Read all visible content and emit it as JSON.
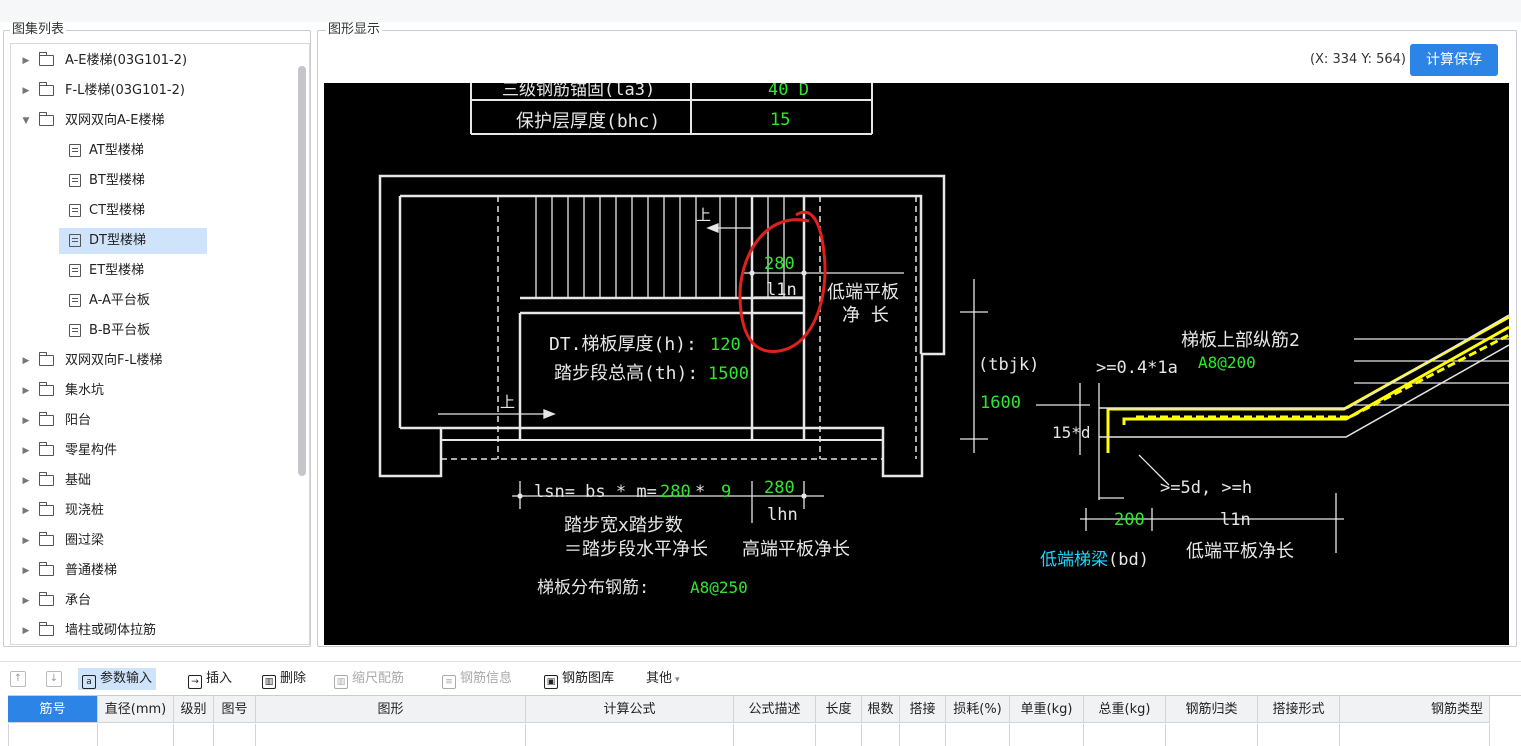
{
  "left_panel": {
    "title": "图集列表",
    "tree": [
      {
        "label": "A-E楼梯(03G101-2)",
        "type": "folder",
        "level": 0,
        "expanded": false
      },
      {
        "label": "F-L楼梯(03G101-2)",
        "type": "folder",
        "level": 0,
        "expanded": false
      },
      {
        "label": "双网双向A-E楼梯",
        "type": "folder",
        "level": 0,
        "expanded": true
      },
      {
        "label": "AT型楼梯",
        "type": "doc",
        "level": 1
      },
      {
        "label": "BT型楼梯",
        "type": "doc",
        "level": 1
      },
      {
        "label": "CT型楼梯",
        "type": "doc",
        "level": 1
      },
      {
        "label": "DT型楼梯",
        "type": "doc",
        "level": 1,
        "selected": true
      },
      {
        "label": "ET型楼梯",
        "type": "doc",
        "level": 1
      },
      {
        "label": "A-A平台板",
        "type": "doc",
        "level": 1
      },
      {
        "label": "B-B平台板",
        "type": "doc",
        "level": 1
      },
      {
        "label": "双网双向F-L楼梯",
        "type": "folder",
        "level": 0,
        "expanded": false
      },
      {
        "label": "集水坑",
        "type": "folder",
        "level": 0,
        "expanded": false
      },
      {
        "label": "阳台",
        "type": "folder",
        "level": 0,
        "expanded": false
      },
      {
        "label": "零星构件",
        "type": "folder",
        "level": 0,
        "expanded": false
      },
      {
        "label": "基础",
        "type": "folder",
        "level": 0,
        "expanded": false
      },
      {
        "label": "现浇桩",
        "type": "folder",
        "level": 0,
        "expanded": false
      },
      {
        "label": "圈过梁",
        "type": "folder",
        "level": 0,
        "expanded": false
      },
      {
        "label": "普通楼梯",
        "type": "folder",
        "level": 0,
        "expanded": false
      },
      {
        "label": "承台",
        "type": "folder",
        "level": 0,
        "expanded": false
      },
      {
        "label": "墙柱或砌体拉筋",
        "type": "folder",
        "level": 0,
        "expanded": false
      }
    ]
  },
  "right_panel": {
    "title": "图形显示",
    "coord_readout": "(X: 334 Y: 564)",
    "save_button": "计算保存"
  },
  "drawing": {
    "table_row1_label": "三级钢筋锚固(la3)",
    "table_row1_value": "40 D",
    "table_row2_label": "保护层厚度(bhc)",
    "table_row2_value": "15",
    "up_label": "上",
    "val_280": "280",
    "ln_label": "l1n",
    "low_slab_1": "低端平板",
    "low_slab_2": "净  长",
    "thickness_label": "DT.梯板厚度(h):",
    "thickness_value": "120",
    "height_label": "踏步段总高(th):",
    "height_value": "1500",
    "lsn_label": "lsn= bs * m=",
    "lsn_bs": "280",
    "lsn_star": "*",
    "lsn_m": "9",
    "hn_val": "280",
    "hn_label": "lhn",
    "step_note": "踏步宽x踏步数",
    "horiz_note": "＝踏步段水平净长",
    "high_slab_note": "高端平板净长",
    "distrib_label": "梯板分布钢筋:",
    "distrib_value": "A8@250",
    "tbjk": "(tbjk)",
    "tbjk_value": "1600",
    "top_bar_label": "梯板上部纵筋2",
    "top_bar_value": "A8@200",
    "anchor_04": ">=0.4*1a",
    "d15": "15*d",
    "d5": ">=5d, >=h",
    "val_200": "200",
    "ln2": "l1n",
    "low_beam": "低端梯梁",
    "bd": "(bd)",
    "low_slab_len": "低端平板净长"
  },
  "toolbar": {
    "param_input": "参数输入",
    "insert": "插入",
    "delete": "删除",
    "scale": "缩尺配筋",
    "rebar_info": "钢筋信息",
    "rebar_lib": "钢筋图库",
    "other": "其他"
  },
  "grid": {
    "columns": [
      "筋号",
      "直径(mm)",
      "级别",
      "图号",
      "图形",
      "计算公式",
      "公式描述",
      "长度",
      "根数",
      "搭接",
      "损耗(%)",
      "单重(kg)",
      "总重(kg)",
      "钢筋归类",
      "搭接形式",
      "钢筋类型"
    ]
  },
  "colors": {
    "accent": "#2b84e6",
    "selected_bg": "#cfe3fb",
    "cad_green": "#2ee82e",
    "cad_yellow": "#ffff00",
    "cad_cyan": "#19d8ff",
    "annotation_red": "#e0201a"
  }
}
